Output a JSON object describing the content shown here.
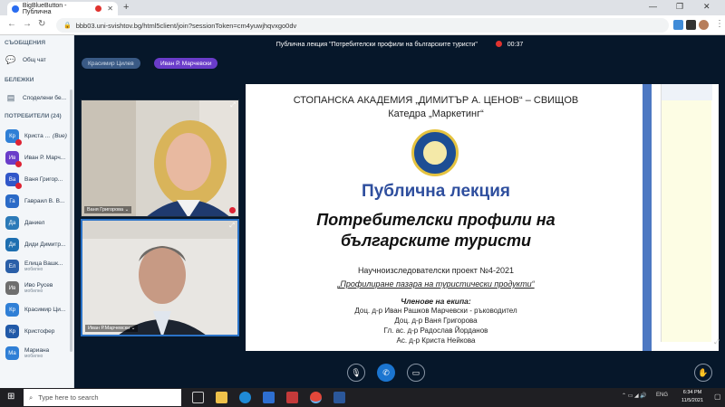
{
  "browser": {
    "tab_title": "BigBlueButton - Публична",
    "url": "bbb03.uni-svishtov.bg/html5client/join?sessionToken=cm4yuwjhqvxgo0dv",
    "new_tab": "+",
    "minimize": "—",
    "maximize": "❐",
    "close": "✕"
  },
  "sidebar": {
    "messages_header": "СЪОБЩЕНИЯ",
    "public_chat": "Общ чат",
    "notes_header": "БЕЛЕЖКИ",
    "shared_notes": "Споделени бе...",
    "users_header": "ПОТРЕБИТЕЛИ (24)",
    "users": [
      {
        "initials": "Кр",
        "name": "Криста ...",
        "suffix": "(Вие)",
        "sub": "",
        "color": "#2f7fd6",
        "mic": "#d23"
      },
      {
        "initials": "Ив",
        "name": "Иван Р. Марч...",
        "sub": "",
        "color": "#6a3cc9",
        "mic": "#d23"
      },
      {
        "initials": "Ва",
        "name": "Ваня Григор...",
        "sub": "",
        "color": "#3157c9",
        "mic": "#d23"
      },
      {
        "initials": "Га",
        "name": "Гавраил В. В...",
        "sub": "",
        "color": "#2a6ac7",
        "mic": ""
      },
      {
        "initials": "Да",
        "name": "Даниел",
        "sub": "",
        "color": "#2b7ab8",
        "mic": ""
      },
      {
        "initials": "Ди",
        "name": "Диди Димитр...",
        "sub": "",
        "color": "#1e6fb0",
        "mic": ""
      },
      {
        "initials": "Ел",
        "name": "Елица Вашк...",
        "sub": "мобилно",
        "color": "#2a5fa8",
        "mic": ""
      },
      {
        "initials": "Ив",
        "name": "Иво Русев",
        "sub": "мобилно",
        "color": "#6e6e6e",
        "mic": ""
      },
      {
        "initials": "Кр",
        "name": "Красимир Ци...",
        "sub": "",
        "color": "#2f7fd6",
        "mic": ""
      },
      {
        "initials": "Кр",
        "name": "Кристофер",
        "sub": "",
        "color": "#2059a8",
        "mic": ""
      },
      {
        "initials": "Ма",
        "name": "Мариана",
        "sub": "мобилно",
        "color": "#2f7fd6",
        "mic": ""
      }
    ]
  },
  "meeting": {
    "title": "Публична лекция \"Потребителски профили на българските туристи\"",
    "timer": "00:37",
    "talkers": [
      "Красимир Цилев",
      "Иван Р. Марчевски"
    ],
    "videos": [
      {
        "label": "Ваня Григорова ⌄"
      },
      {
        "label": "Иван Р.Марчевски ⌄"
      }
    ]
  },
  "slide": {
    "academy": "СТОПАНСКА АКАДЕМИЯ „ДИМИТЪР А. ЦЕНОВ“ – СВИЩОВ",
    "department": "Катедра „Маркетинг“",
    "heading": "Публична лекция",
    "title_line1": "Потребителски профили на",
    "title_line2": "българските туристи",
    "project": "Научноизследователски проект №4-2021",
    "project_name": "„Профилиране пазара на туристически продукти“",
    "team_header": "Членове на екипа:",
    "team": [
      "Доц. д-р Иван Рашков Марчевски - ръководител",
      "Доц. д-р Ваня Григорова",
      "Гл. ас. д-р Радослав Йорданов",
      "Ас. д-р Криста Нейкова"
    ]
  },
  "taskbar": {
    "search_placeholder": "Type here to search",
    "language": "ENG",
    "time": "6:34 PM",
    "date": "11/5/2021"
  }
}
